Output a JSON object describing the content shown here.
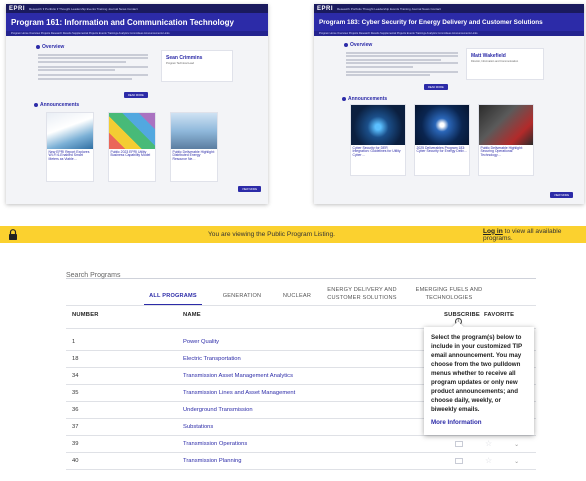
{
  "left_shot": {
    "logo": "EPRI",
    "nav": "Research ▾  Portfolio ▾  Thought Leadership  Events  Training  Journal  News  Contact",
    "title": "Program 161: Information and Communication Technology",
    "subnav": "Program Home   Overview   Projects   Research Results   Supplemental Projects   Events   Trainings   Analytics   Committees   Announcements   Links",
    "overview_title": "Overview",
    "contact_name": "Sean Crimmins",
    "contact_sub": "Program Technical Lead",
    "read_more": "READ MORE",
    "announcements_title": "Announcements",
    "cards": [
      "New EPRI Report Explores Wi-Fi 6-Enabled Smart Meters as Viable…",
      "Public 2023 EPRI Utility Business Capability Model",
      "Public Deliverable Highlight: Distributed Energy Resource Ne…"
    ],
    "view_more": "VIEW MORE"
  },
  "right_shot": {
    "logo": "EPRI",
    "nav": "Research  Portfolio  Thought Leadership  Events  Training  Journal  News  Contact",
    "title": "Program 183: Cyber Security for Energy Delivery and Customer Solutions",
    "subnav": "Program Home   Overview   Projects   Research Results   Supplemental Projects   Events   Trainings   Analytics   Committees   Announcements   Links",
    "overview_title": "Overview",
    "contact_name": "Matt Wakefield",
    "contact_sub": "Director, Information and Communication",
    "read_more": "READ MORE",
    "announcements_title": "Announcements",
    "cards": [
      "Cyber Security for DER Integration: Guidelines for Utility Cyber…",
      "2025 Deliverables Program 183: Cyber Security for Energy Deliv…",
      "Public Deliverable Highlight: Securing Operational Technology…"
    ],
    "view_more": "VIEW MORE"
  },
  "banner": {
    "message": "You are viewing the Public Program Listing.",
    "login_link": "Log in",
    "login_suffix": " to view all available programs."
  },
  "search": {
    "placeholder": "Search Programs"
  },
  "tabs": [
    "ALL PROGRAMS",
    "GENERATION",
    "NUCLEAR",
    "ENERGY DELIVERY AND CUSTOMER SOLUTIONS",
    "EMERGING FUELS AND TECHNOLOGIES"
  ],
  "columns": {
    "number": "NUMBER",
    "name": "NAME",
    "subscribe": "SUBSCRIBE",
    "favorite": "FAVORITE"
  },
  "rows": [
    {
      "number": "1",
      "name": "Power Quality"
    },
    {
      "number": "18",
      "name": "Electric Transportation"
    },
    {
      "number": "34",
      "name": "Transmission Asset Management Analytics"
    },
    {
      "number": "35",
      "name": "Transmission Lines and Asset Management"
    },
    {
      "number": "36",
      "name": "Underground Transmission"
    },
    {
      "number": "37",
      "name": "Substations"
    },
    {
      "number": "39",
      "name": "Transmission Operations"
    },
    {
      "number": "40",
      "name": "Transmission Planning"
    }
  ],
  "tooltip": {
    "text": "Select the program(s) below to include in your customized TIP email announcement. You may choose from the two pulldown menus whether to receive all program updates or only new product announcements; and choose daily, weekly, or biweekly emails.",
    "link": "More Information"
  },
  "colors": {
    "accent": "#2c2ba8",
    "banner": "#fbd12f"
  }
}
